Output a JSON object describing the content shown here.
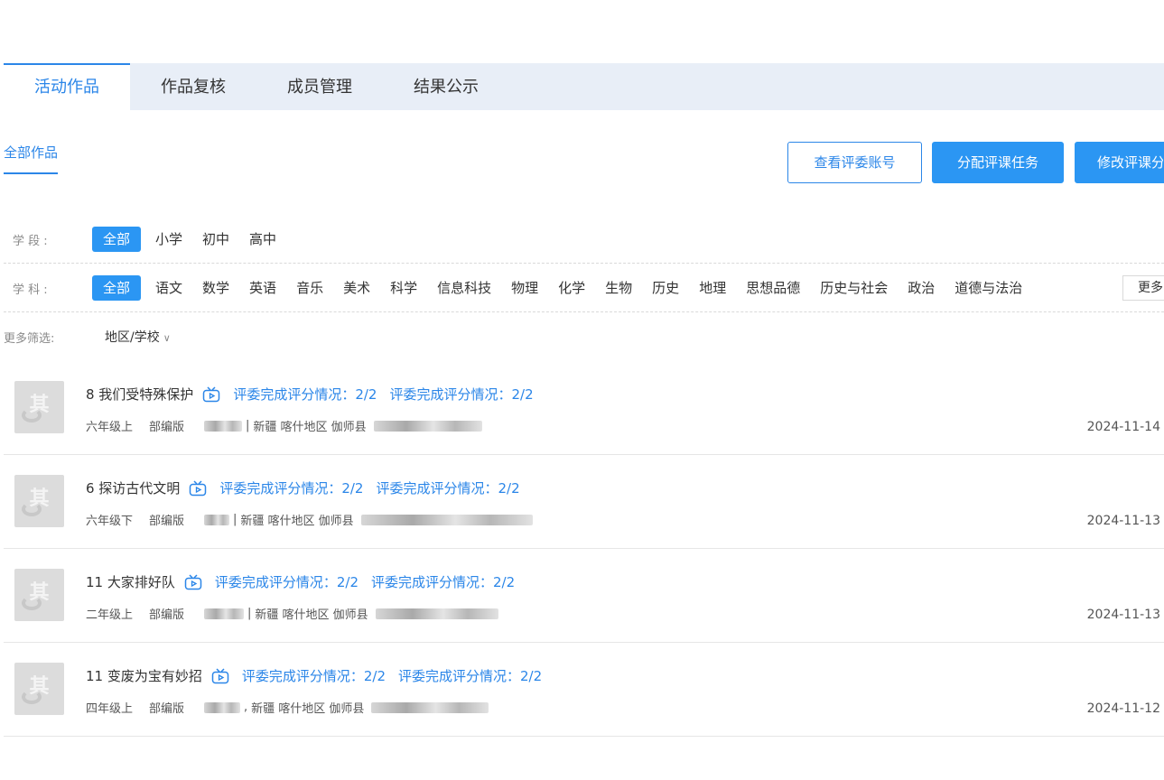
{
  "tabs": [
    {
      "label": "活动作品",
      "active": true
    },
    {
      "label": "作品复核",
      "active": false
    },
    {
      "label": "成员管理",
      "active": false
    },
    {
      "label": "结果公示",
      "active": false
    }
  ],
  "subtab": {
    "label": "全部作品"
  },
  "actions": {
    "view_judges": "查看评委账号",
    "assign_tasks": "分配评课任务",
    "modify_tasks": "修改评课分"
  },
  "filters": {
    "stage": {
      "label": "学 段 :",
      "options": [
        "全部",
        "小学",
        "初中",
        "高中"
      ],
      "selected": "全部"
    },
    "subject": {
      "label": "学 科 :",
      "options": [
        "全部",
        "语文",
        "数学",
        "英语",
        "音乐",
        "美术",
        "科学",
        "信息科技",
        "物理",
        "化学",
        "生物",
        "历史",
        "地理",
        "思想品德",
        "历史与社会",
        "政治",
        "道德与法治"
      ],
      "selected": "全部",
      "more": "更多"
    },
    "more": {
      "label": "更多筛选:",
      "region_select": "地区/学校"
    }
  },
  "colors": {
    "accent": "#2b86e8",
    "primary_button": "#2b96f3",
    "tab_bar": "#e8eef7"
  },
  "items": [
    {
      "title": "8 我们受特殊保护",
      "score1": "评委完成评分情况：2/2",
      "score2": "评委完成评分情况：2/2",
      "grade": "六年级上",
      "edition": "部编版",
      "sep": "|",
      "region": "新疆 喀什地区 伽师县",
      "date": "2024-11-14"
    },
    {
      "title": "6 探访古代文明",
      "score1": "评委完成评分情况：2/2",
      "score2": "评委完成评分情况：2/2",
      "grade": "六年级下",
      "edition": "部编版",
      "sep": "|",
      "region": "新疆 喀什地区 伽师县",
      "date": "2024-11-13"
    },
    {
      "title": "11 大家排好队",
      "score1": "评委完成评分情况：2/2",
      "score2": "评委完成评分情况：2/2",
      "grade": "二年级上",
      "edition": "部编版",
      "sep": "|",
      "region": "新疆 喀什地区 伽师县",
      "date": "2024-11-13"
    },
    {
      "title": "11 变废为宝有妙招",
      "score1": "评委完成评分情况：2/2",
      "score2": "评委完成评分情况：2/2",
      "grade": "四年级上",
      "edition": "部编版",
      "sep": ",",
      "region": "新疆 喀什地区 伽师县",
      "date": "2024-11-12"
    }
  ]
}
